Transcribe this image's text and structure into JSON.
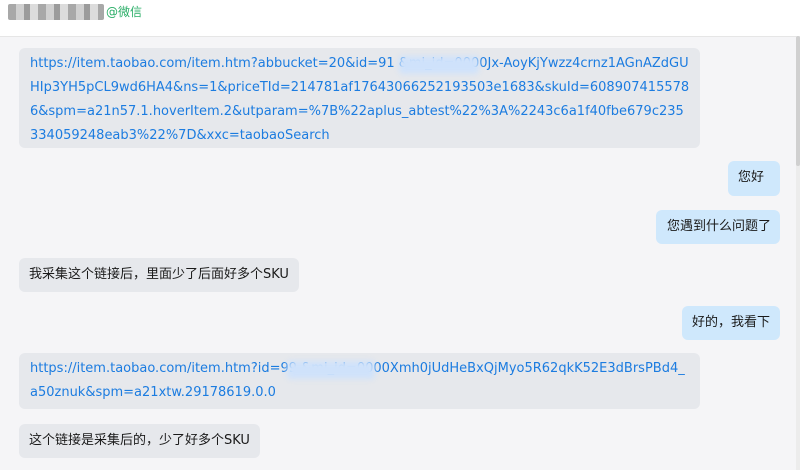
{
  "header": {
    "contact_name": "■■■■■■",
    "source_tag": "@微信"
  },
  "messages": [
    {
      "side": "left",
      "type": "link",
      "text": "https://item.taobao.com/item.htm?abbucket=20&id=91          &mi_id=0000Jx-AoyKjYwzz4crnz1AGnAZdGUHIp3YH5pCL9wd6HA4&ns=1&priceTId=214781af17643066252193503e1683&skuId=6089074155786&spm=a21n57.1.hoverItem.2&utparam=%7B%22aplus_abtest%22%3A%2243c6a1f40fbe679c235334059248eab3%22%7D&xxc=taobaoSearch"
    },
    {
      "side": "right",
      "type": "text",
      "text": "您好"
    },
    {
      "side": "right",
      "type": "text",
      "text": "您遇到什么问题了"
    },
    {
      "side": "left",
      "type": "text",
      "text": "我采集这个链接后，里面少了后面好多个SKU"
    },
    {
      "side": "right",
      "type": "text",
      "text": "好的，我看下"
    },
    {
      "side": "left",
      "type": "link",
      "text": "https://item.taobao.com/item.htm?id=99          &mi_id=0000Xmh0jUdHeBxQjMyo5R62qkK52E3dBrsPBd4_a50znuk&spm=a21xtw.29178619.0.0"
    },
    {
      "side": "left",
      "type": "text",
      "text": "这个链接是采集后的，少了好多个SKU"
    }
  ]
}
